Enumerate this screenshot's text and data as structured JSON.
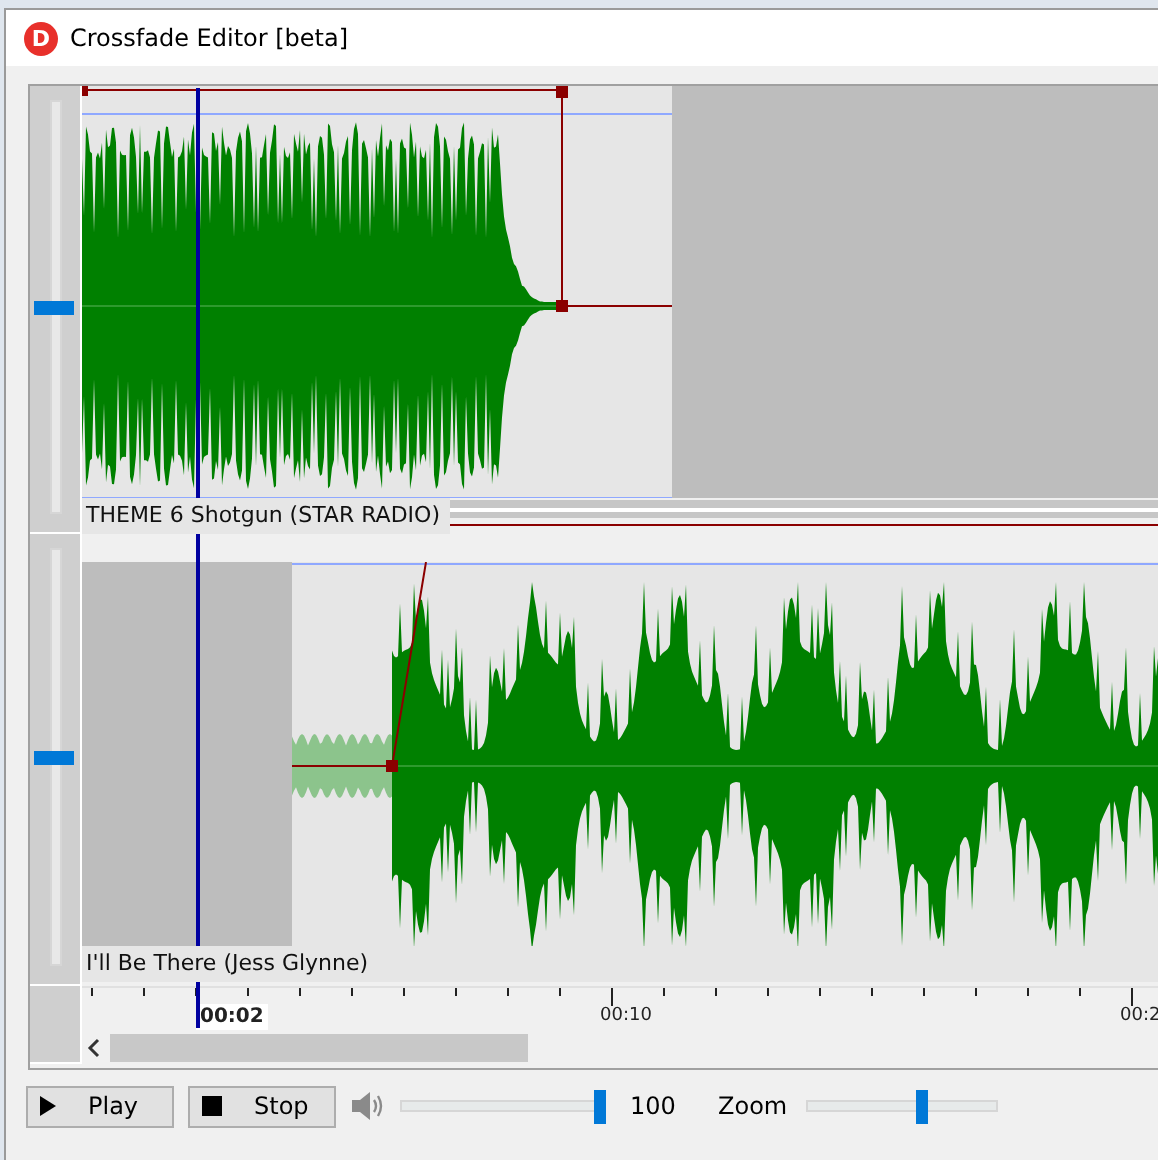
{
  "window": {
    "icon_letter": "D",
    "title": "Crossfade Editor [beta]"
  },
  "tracks": [
    {
      "name": "THEME 6 Shotgun (STAR RADIO)",
      "volume": {
        "level": 0.5
      }
    },
    {
      "name": "I'll Be There (Jess Glynne)",
      "volume": {
        "level": 0.5
      }
    }
  ],
  "ruler": {
    "labels": [
      {
        "text": "00:02",
        "current": true
      },
      {
        "text": "00:10",
        "current": false
      },
      {
        "text": "00:2",
        "current": false
      }
    ]
  },
  "controls": {
    "play": "Play",
    "stop": "Stop",
    "volume": {
      "level": 0.97
    },
    "volume_reading": "100",
    "zoom_label": "Zoom",
    "zoom": {
      "level": 0.6
    }
  }
}
